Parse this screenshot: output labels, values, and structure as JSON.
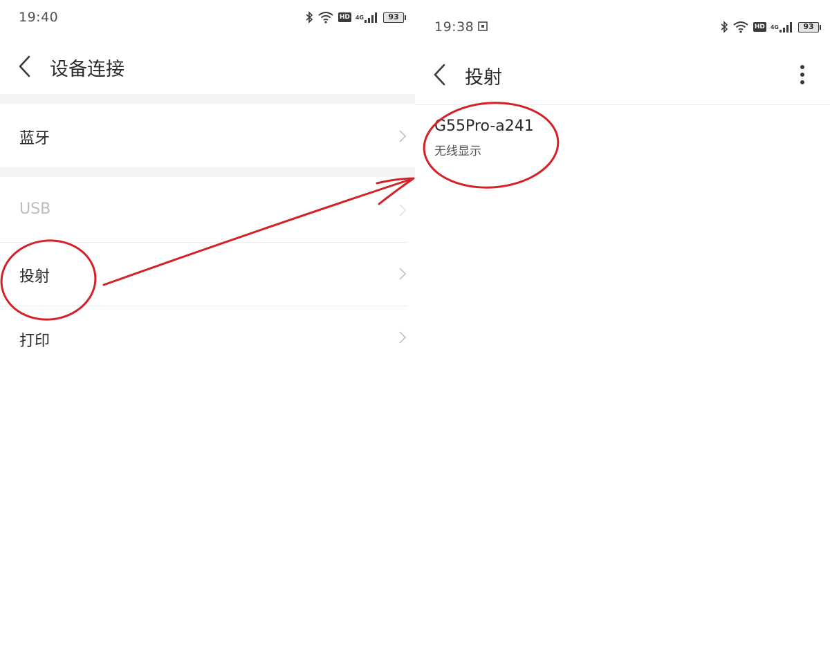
{
  "left_screen": {
    "status": {
      "time": "19:40",
      "hd_label": "HD",
      "network_label": "4G",
      "battery_level": "93"
    },
    "title": "设备连接",
    "items": [
      {
        "label": "蓝牙",
        "enabled": true
      },
      {
        "label": "USB",
        "enabled": false
      },
      {
        "label": "投射",
        "enabled": true
      },
      {
        "label": "打印",
        "enabled": true
      }
    ]
  },
  "right_screen": {
    "status": {
      "time": "19:38",
      "hd_label": "HD",
      "network_label": "4G",
      "battery_level": "93"
    },
    "title": "投射",
    "devices": [
      {
        "name": "G55Pro-a241",
        "type": "无线显示"
      }
    ]
  },
  "icons": {
    "back": "back-arrow-icon",
    "more": "more-vertical-icon",
    "chevron": "chevron-right-icon",
    "bluetooth": "bluetooth-icon",
    "wifi": "wifi-icon",
    "signal": "signal-bars-icon",
    "battery": "battery-icon",
    "screenshot": "screen-capture-icon"
  },
  "colors": {
    "annotation_red": "#d42026",
    "divider": "#ececec",
    "section_gap": "#f4f4f4",
    "disabled_text": "#bdbdbd"
  }
}
